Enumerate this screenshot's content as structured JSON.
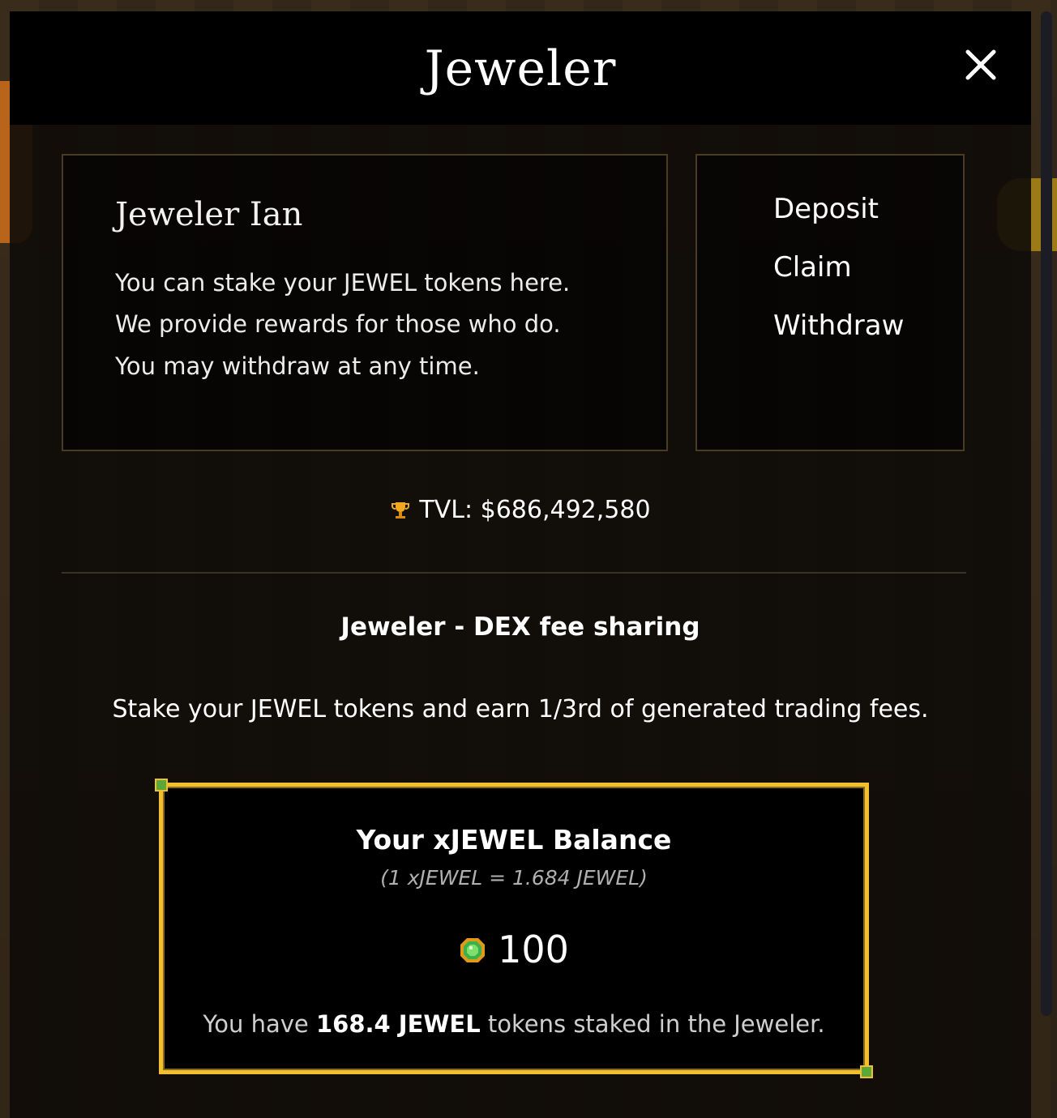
{
  "modal": {
    "title": "Jeweler",
    "close_icon": "close-icon"
  },
  "npc": {
    "name": "Jeweler Ian",
    "lines": [
      "You can stake your JEWEL tokens here.",
      "We provide rewards for those who do.",
      "You may withdraw at any time."
    ]
  },
  "actions": [
    "Deposit",
    "Claim",
    "Withdraw"
  ],
  "stats": {
    "tvl_icon": "trophy-icon",
    "tvl_text": "TVL: $686,492,580"
  },
  "section": {
    "title": "Jeweler - DEX fee sharing",
    "description": "Stake your JEWEL tokens and earn 1/3rd of generated trading fees."
  },
  "balance": {
    "title": "Your xJEWEL Balance",
    "rate": "(1 xJEWEL = 1.684 JEWEL)",
    "token_icon": "jewel-gem-icon",
    "amount": "100",
    "staked_prefix": "You have ",
    "staked_amount": "168.4 JEWEL",
    "staked_suffix": " tokens staked in the Jeweler."
  },
  "colors": {
    "accent_gold": "#f2c02e",
    "panel_border": "#4a3c24",
    "text_primary": "#ffffff"
  }
}
